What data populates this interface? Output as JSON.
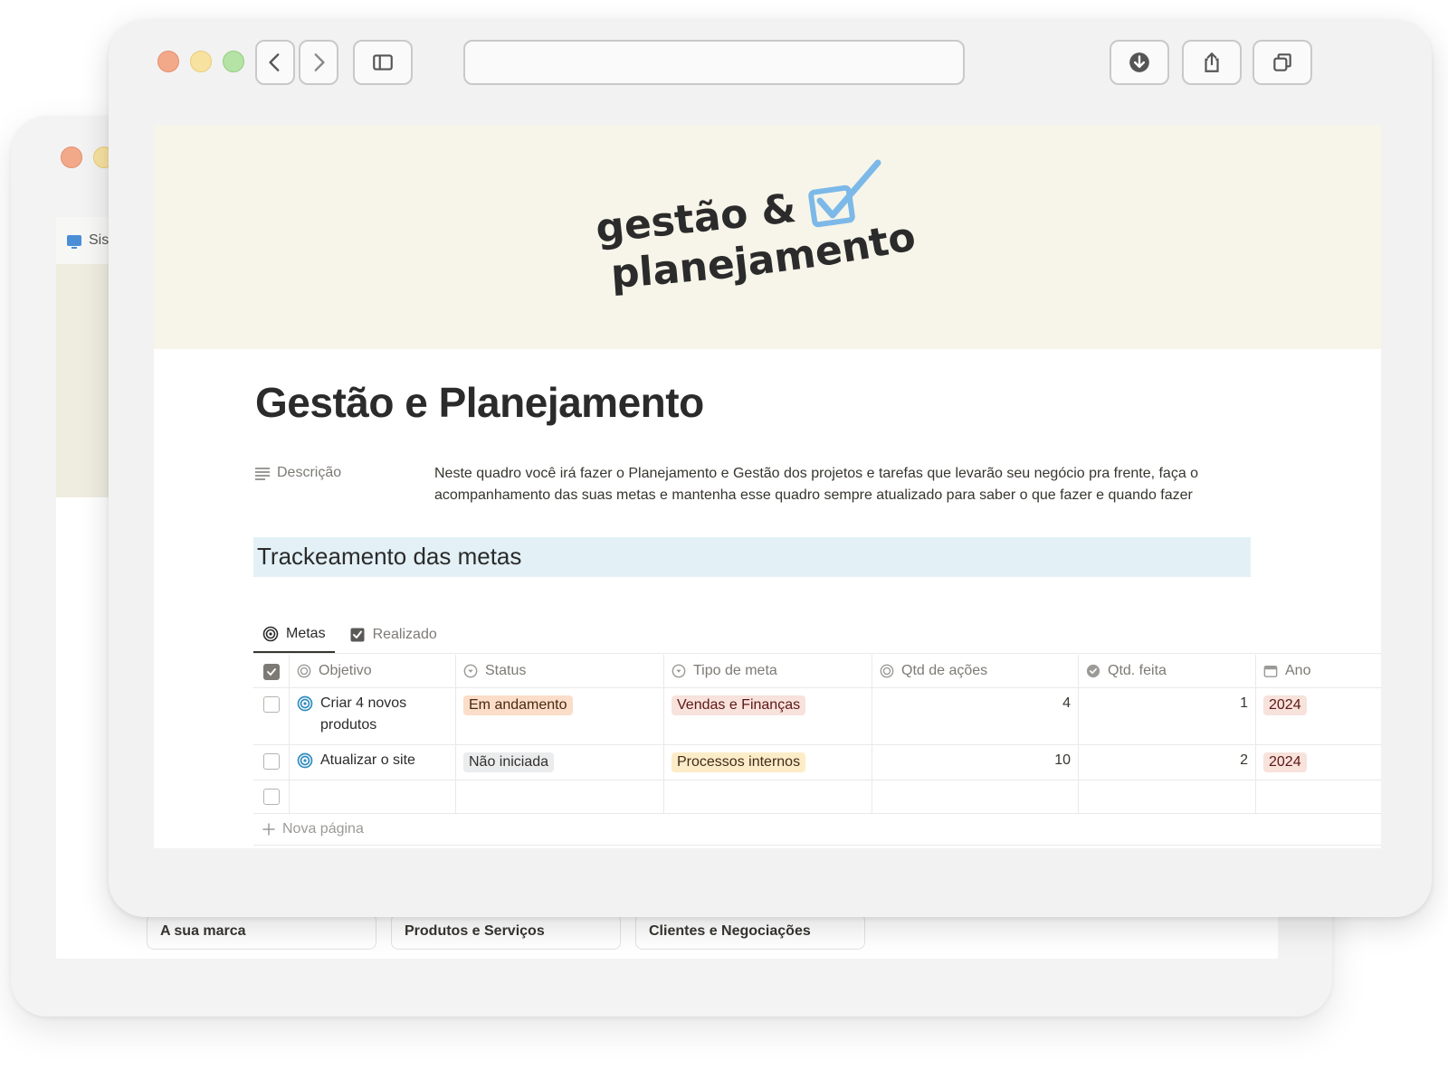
{
  "back_window": {
    "tab_label": "Sis",
    "cards": [
      "A sua marca",
      "Produtos e Serviços",
      "Clientes e Negociações"
    ]
  },
  "browser": {
    "buttons": [
      "back-icon",
      "forward-icon",
      "sidebar-icon",
      "download-icon",
      "share-icon",
      "tabs-icon"
    ]
  },
  "cover": {
    "logo_line1": "gestão &",
    "logo_line2": "planejamento",
    "accent": "#7cb9e8"
  },
  "page": {
    "title": "Gestão e Planejamento",
    "property_label": "Descrição",
    "property_value": "Neste quadro você irá fazer o Planejamento e Gestão dos projetos e tarefas que levarão seu negócio pra frente, faça o acompanhamento das suas metas e mantenha esse quadro sempre atualizado para saber o que fazer e quando fazer",
    "section_title": "Trackeamento das metas"
  },
  "tabs": [
    {
      "label": "Metas",
      "icon": "target-icon",
      "active": true
    },
    {
      "label": "Realizado",
      "icon": "checkbox-icon",
      "active": false
    }
  ],
  "table": {
    "columns": [
      "Objetivo",
      "Status",
      "Tipo de meta",
      "Qtd de ações",
      "Qtd. feita",
      "Ano"
    ],
    "rows": [
      {
        "objetivo": "Criar 4 novos produtos",
        "status": "Em andamento",
        "tipo": "Vendas e Finanças",
        "qtd_acoes": "4",
        "qtd_feita": "1",
        "ano": "2024"
      },
      {
        "objetivo": "Atualizar o site",
        "status": "Não iniciada",
        "tipo": "Processos internos",
        "qtd_acoes": "10",
        "qtd_feita": "2",
        "ano": "2024"
      }
    ],
    "new_page_label": "Nova página"
  }
}
